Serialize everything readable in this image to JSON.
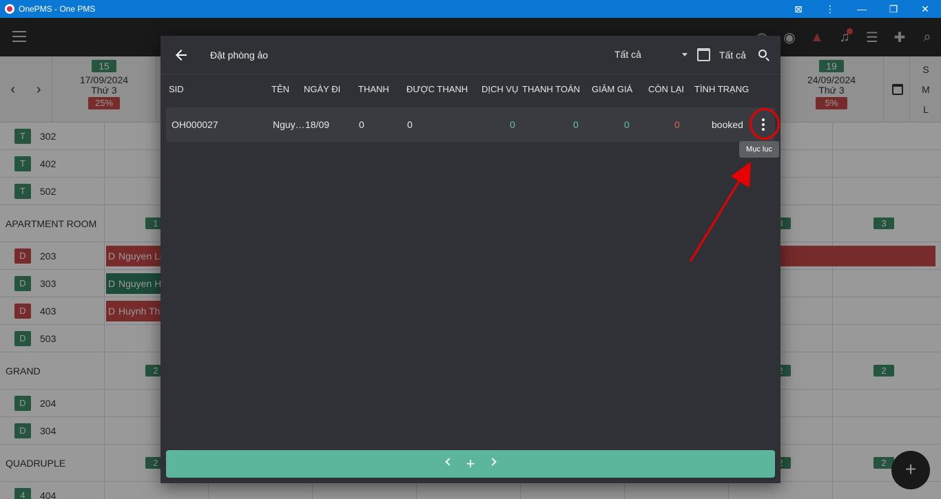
{
  "window": {
    "title": "OnePMS - One PMS",
    "minimize": "—",
    "restore": "❐",
    "close": "✕",
    "translate": "⊠",
    "more": "⋮"
  },
  "calendar": {
    "days": [
      {
        "num": "15",
        "date": "17/09/2024",
        "weekday": "Thứ 3",
        "occupancy": "25%"
      },
      {
        "num": "19",
        "date": "24/09/2024",
        "weekday": "Thứ 3",
        "occupancy": "5%"
      }
    ],
    "sizes": [
      "S",
      "M",
      "L"
    ]
  },
  "rooms": {
    "rows": [
      {
        "type": "room",
        "badge": "T",
        "num": "302"
      },
      {
        "type": "room",
        "badge": "T",
        "num": "402"
      },
      {
        "type": "room",
        "badge": "T",
        "num": "502"
      },
      {
        "type": "cat",
        "name": "APARTMENT ROOM",
        "avail_left": "1",
        "avail_mid": "3",
        "avail_right": "3"
      },
      {
        "type": "room",
        "badge": "D",
        "num": "203",
        "guest": "Nguyen Li"
      },
      {
        "type": "room",
        "badge": "D",
        "num": "303",
        "guest": "Nguyen H"
      },
      {
        "type": "room",
        "badge": "D",
        "num": "403",
        "guest": "Huynh Th"
      },
      {
        "type": "room",
        "badge": "D",
        "num": "503"
      },
      {
        "type": "cat",
        "name": "GRAND",
        "avail_left": "2",
        "avail_mid": "2",
        "avail_right": "2"
      },
      {
        "type": "room",
        "badge": "D",
        "num": "204"
      },
      {
        "type": "room",
        "badge": "D",
        "num": "304"
      },
      {
        "type": "cat",
        "name": "QUADRUPLE",
        "avail_left": "2",
        "avail_mid": "2",
        "avail_right": "2"
      },
      {
        "type": "room",
        "badge": "4",
        "num": "404"
      }
    ],
    "booking_badge": "D"
  },
  "fab": {
    "label": "+"
  },
  "dialog": {
    "title": "Đặt phòng ảo",
    "filter_value": "Tất cả",
    "date_value": "Tất cả",
    "columns": [
      "SID",
      "TÊN",
      "NGÀY ĐI",
      "THANH",
      "ĐƯỢC THANH",
      "DỊCH VỤ",
      "THANH TOÁN",
      "GIẢM GIÁ",
      "CÒN LẠI",
      "TÌNH TRẠNG"
    ],
    "rows": [
      {
        "sid": "OH000027",
        "name": "Nguy…",
        "checkout": "18/09",
        "thanh": "0",
        "duoc_thanh": "0",
        "dich_vu": "0",
        "thanh_toan": "0",
        "giam_gia": "0",
        "con_lai": "0",
        "status": "booked"
      }
    ],
    "menu_tooltip": "Mục lục",
    "pager_add": "+"
  },
  "colors": {
    "accent": "#5bb69b",
    "danger": "#c84848",
    "dialog_bg": "#303136",
    "annotation": "#e60000"
  }
}
